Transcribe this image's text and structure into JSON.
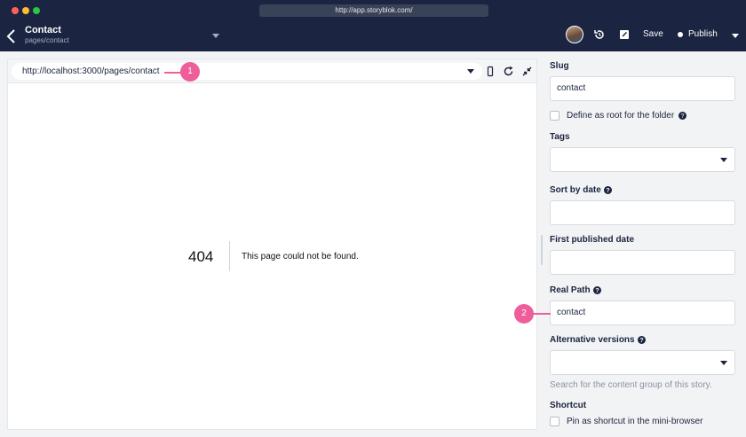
{
  "browser": {
    "url": "http://app.storyblok.com/"
  },
  "header": {
    "title": "Contact",
    "path": "pages/contact",
    "save_label": "Save",
    "publish_label": "Publish"
  },
  "preview": {
    "url": "http://localhost:3000/pages/contact",
    "error_code": "404",
    "error_message": "This page could not be found."
  },
  "callouts": {
    "one": "1",
    "two": "2"
  },
  "fields": {
    "slug": {
      "label": "Slug",
      "value": "contact"
    },
    "define_root": {
      "label": "Define as root for the folder"
    },
    "tags": {
      "label": "Tags",
      "value": ""
    },
    "sort_by_date": {
      "label": "Sort by date",
      "value": ""
    },
    "first_published": {
      "label": "First published date",
      "value": ""
    },
    "real_path": {
      "label": "Real Path",
      "value": "contact"
    },
    "alternative_versions": {
      "label": "Alternative versions",
      "value": "",
      "hint": "Search for the content group of this story."
    },
    "shortcut": {
      "label": "Shortcut",
      "checkbox_label": "Pin as shortcut in the mini-browser"
    }
  },
  "colors": {
    "header_bg": "#1b2440",
    "accent_badge": "#ee5e9b"
  }
}
